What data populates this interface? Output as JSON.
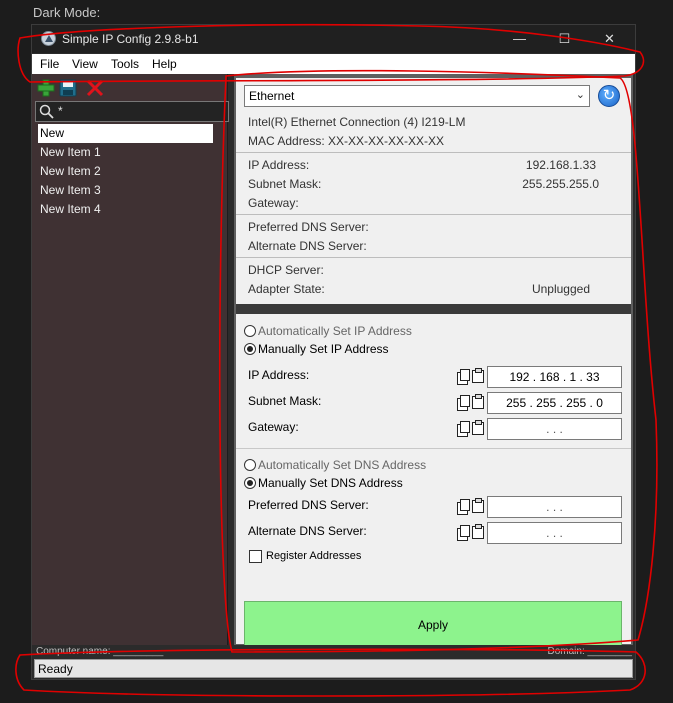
{
  "page_label": "Dark Mode:",
  "window": {
    "title": "Simple IP Config 2.9.8-b1",
    "controls": {
      "minimize": "—",
      "maximize": "☐",
      "close": "✕"
    }
  },
  "menu": {
    "file": "File",
    "view": "View",
    "tools": "Tools",
    "help": "Help"
  },
  "toolbar": {
    "icons": [
      "add-icon",
      "save-icon",
      "delete-icon"
    ]
  },
  "search": {
    "value": "*"
  },
  "profiles": [
    "New",
    "New Item 1",
    "New Item 2",
    "New Item 3",
    "New Item 4"
  ],
  "adapter": {
    "selected": "Ethernet",
    "description": "Intel(R) Ethernet Connection (4) I219-LM",
    "mac": "MAC Address: XX-XX-XX-XX-XX-XX"
  },
  "current": {
    "ip_label": "IP Address:",
    "ip_value": "192.168.1.33",
    "subnet_label": "Subnet Mask:",
    "subnet_value": "255.255.255.0",
    "gateway_label": "Gateway:",
    "gateway_value": "",
    "pdns_label": "Preferred DNS Server:",
    "pdns_value": "",
    "adns_label": "Alternate DNS Server:",
    "adns_value": "",
    "dhcp_label": "DHCP Server:",
    "dhcp_value": "",
    "state_label": "Adapter State:",
    "state_value": "Unplugged"
  },
  "settings": {
    "auto_ip": "Automatically Set IP Address",
    "manual_ip": "Manually Set IP Address",
    "ip_label": "IP Address:",
    "ip": "192 . 168 . 1 . 33",
    "subnet_label": "Subnet Mask:",
    "subnet": "255 . 255 . 255 . 0",
    "gateway_label": "Gateway:",
    "gateway": ". . .",
    "auto_dns": "Automatically Set DNS Address",
    "manual_dns": "Manually Set DNS Address",
    "pdns_label": "Preferred DNS Server:",
    "pdns": ". . .",
    "adns_label": "Alternate DNS Server:",
    "adns": ". . .",
    "register": "Register Addresses",
    "register_checked": false,
    "apply": "Apply"
  },
  "status": {
    "computer_name": "Computer name: _________",
    "domain": "Domain: ________",
    "text": "Ready"
  },
  "colors": {
    "apply_green": "#8df38d",
    "annotation_red": "#e00000",
    "list_bg": "#3f3133"
  }
}
